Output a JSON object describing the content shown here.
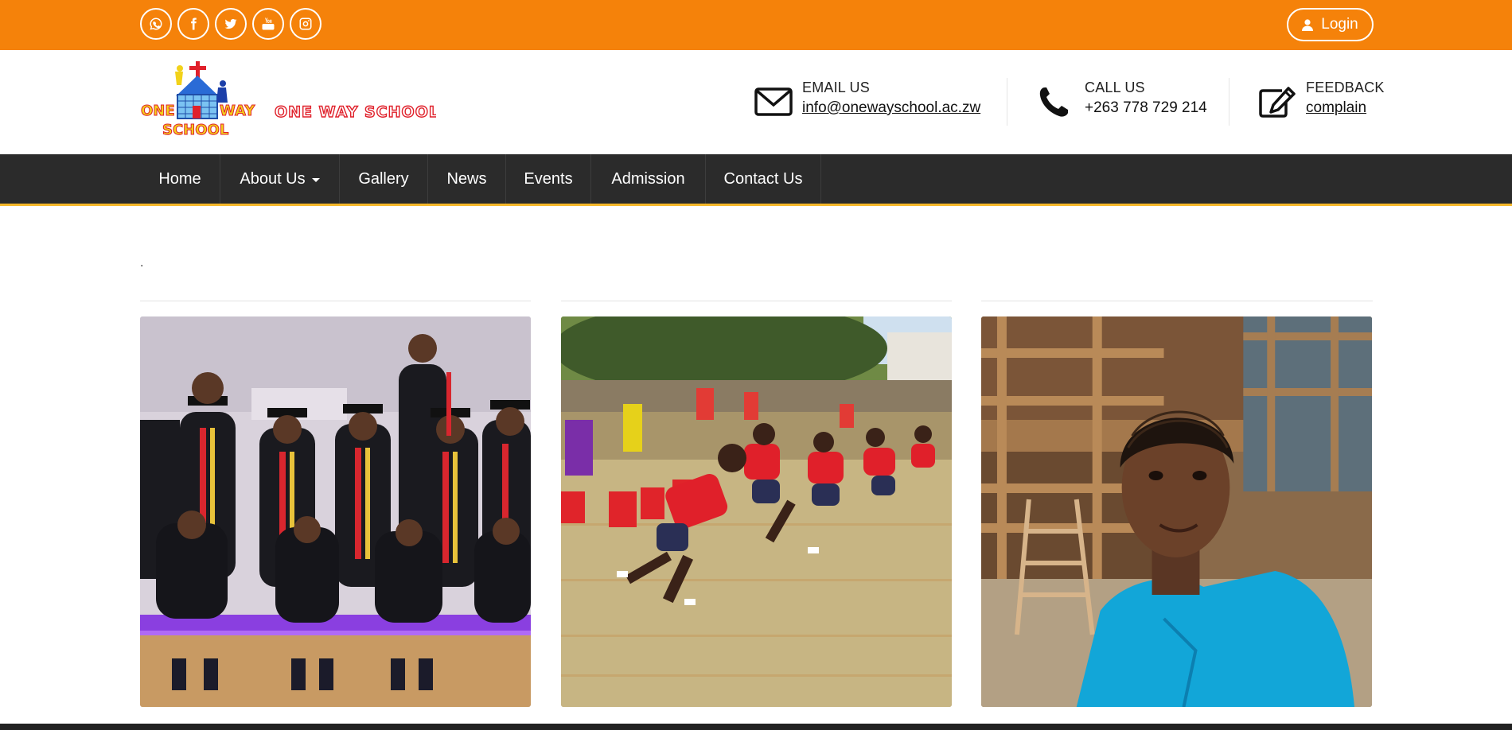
{
  "topbar": {
    "social_icons": [
      "whatsapp-icon",
      "facebook-icon",
      "twitter-icon",
      "youtube-icon",
      "instagram-icon"
    ],
    "login_label": "Login"
  },
  "header": {
    "logo_text": "ONE WAY SCHOOL",
    "logo_badge_top": "ONE",
    "logo_badge_right": "WAY",
    "logo_badge_bottom": "SCHOOL",
    "email": {
      "label": "EMAIL US",
      "value": "info@onewayschool.ac.zw"
    },
    "call": {
      "label": "CALL US",
      "value": "+263 778 729 214"
    },
    "feedback": {
      "label": "FEEDBACK",
      "value": "complain"
    }
  },
  "nav": {
    "items": [
      {
        "label": "Home"
      },
      {
        "label": "About Us",
        "dropdown": true
      },
      {
        "label": "Gallery"
      },
      {
        "label": "News"
      },
      {
        "label": "Events"
      },
      {
        "label": "Admission"
      },
      {
        "label": "Contact Us"
      }
    ]
  },
  "content": {
    "dot_text": ".",
    "photos": [
      {
        "subject": "graduation-photo"
      },
      {
        "subject": "sports-race-photo"
      },
      {
        "subject": "teacher-portrait-photo"
      }
    ]
  },
  "colors": {
    "topbar": "#f5820a",
    "nav": "#2b2b2b",
    "nav_accent": "#f5b82a"
  }
}
